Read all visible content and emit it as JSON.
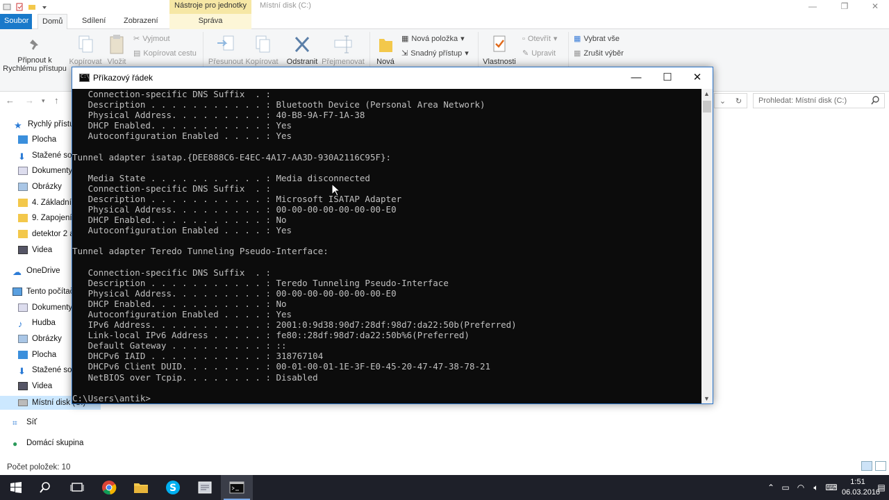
{
  "explorer": {
    "contextual_tab_header": "Nástroje pro jednotky",
    "window_title": "Místní disk (C:)",
    "tabs": {
      "file": "Soubor",
      "home": "Domů",
      "share": "Sdílení",
      "view": "Zobrazení",
      "manage": "Správa"
    },
    "ribbon": {
      "pin": "Připnout k Rychlému přístupu",
      "copy": "Kopírovat",
      "paste": "Vložit",
      "cut": "Vyjmout",
      "copy_path": "Kopírovat cestu",
      "move": "Přesunout",
      "copy_to": "Kopírovat",
      "delete": "Odstranit",
      "rename": "Přejmenovat",
      "new": "Nová",
      "new_item": "Nová položka",
      "easy_access": "Snadný přístup",
      "properties": "Vlastnosti",
      "open": "Otevřít",
      "edit": "Upravit",
      "select_all": "Vybrat vše",
      "select_none": "Zrušit výběr"
    },
    "search_placeholder": "Prohledat: Místní disk (C:)",
    "nav": {
      "quick_access": "Rychlý přístup",
      "items_quick": [
        "Plocha",
        "Stažené soubory",
        "Dokumenty",
        "Obrázky",
        "4. Základní",
        "9. Zapojení",
        "detektor 2 a",
        "Videa"
      ],
      "onedrive": "OneDrive",
      "this_pc": "Tento počítač",
      "items_pc": [
        "Dokumenty",
        "Hudba",
        "Obrázky",
        "Plocha",
        "Stažené soubory",
        "Videa",
        "Místní disk (C:)"
      ],
      "network": "Síť",
      "homegroup": "Domácí skupina"
    },
    "status": "Počet položek: 10"
  },
  "cmd": {
    "title": "Příkazový řádek",
    "lines": [
      "   Connection-specific DNS Suffix  . :",
      "   Description . . . . . . . . . . . : Bluetooth Device (Personal Area Network)",
      "   Physical Address. . . . . . . . . : 40-B8-9A-F7-1A-38",
      "   DHCP Enabled. . . . . . . . . . . : Yes",
      "   Autoconfiguration Enabled . . . . : Yes",
      "",
      "Tunnel adapter isatap.{DEE888C6-E4EC-4A17-AA3D-930A2116C95F}:",
      "",
      "   Media State . . . . . . . . . . . : Media disconnected",
      "   Connection-specific DNS Suffix  . :",
      "   Description . . . . . . . . . . . : Microsoft ISATAP Adapter",
      "   Physical Address. . . . . . . . . : 00-00-00-00-00-00-00-E0",
      "   DHCP Enabled. . . . . . . . . . . : No",
      "   Autoconfiguration Enabled . . . . : Yes",
      "",
      "Tunnel adapter Teredo Tunneling Pseudo-Interface:",
      "",
      "   Connection-specific DNS Suffix  . :",
      "   Description . . . . . . . . . . . : Teredo Tunneling Pseudo-Interface",
      "   Physical Address. . . . . . . . . : 00-00-00-00-00-00-00-E0",
      "   DHCP Enabled. . . . . . . . . . . : No",
      "   Autoconfiguration Enabled . . . . : Yes",
      "   IPv6 Address. . . . . . . . . . . : 2001:0:9d38:90d7:28df:98d7:da22:50b(Preferred)",
      "   Link-local IPv6 Address . . . . . : fe80::28df:98d7:da22:50b%6(Preferred)",
      "   Default Gateway . . . . . . . . . : ::",
      "   DHCPv6 IAID . . . . . . . . . . . : 318767104",
      "   DHCPv6 Client DUID. . . . . . . . : 00-01-00-01-1E-3F-E0-45-20-47-47-38-78-21",
      "   NetBIOS over Tcpip. . . . . . . . : Disabled",
      "",
      "C:\\Users\\antik>"
    ]
  },
  "taskbar": {
    "time": "1:51",
    "date": "06.03.2016",
    "icons": [
      "windows-start-icon",
      "search-icon",
      "task-view-icon",
      "chrome-icon",
      "file-explorer-icon",
      "skype-icon",
      "notepad-icon",
      "cmd-icon"
    ]
  },
  "colors": {
    "accent": "#1979ca",
    "context_tab": "#f6e7a5",
    "console_bg": "#0c0c0c",
    "console_fg": "#c0c0c0",
    "taskbar": "#1e2029",
    "selection": "#cce8ff"
  }
}
